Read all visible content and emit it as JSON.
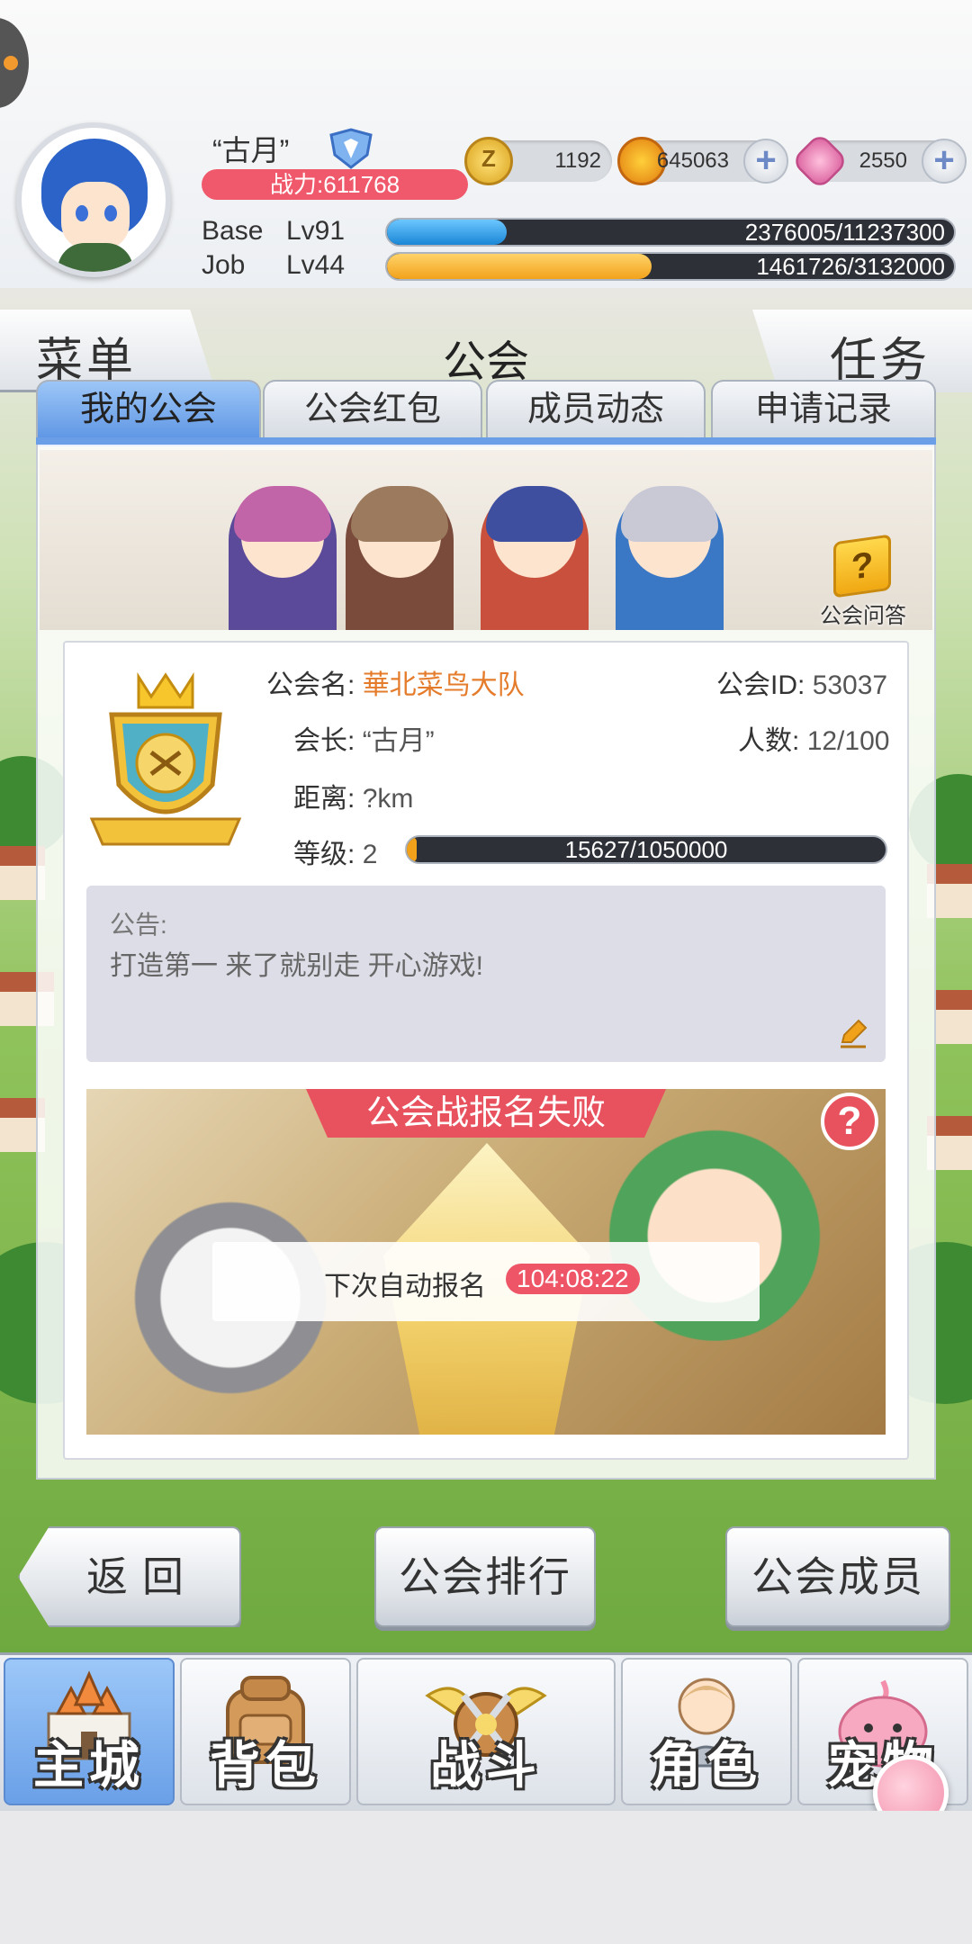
{
  "header": {
    "player_name": "“古月”",
    "power": "战力:611768",
    "currencies": {
      "zeny": "1192",
      "gold": "645063",
      "gem": "2550"
    },
    "base": {
      "label": "Base",
      "level": "Lv91",
      "exp": "2376005/11237300",
      "progress": 0.211
    },
    "job": {
      "label": "Job",
      "level": "Lv44",
      "exp": "1461726/3132000",
      "progress": 0.467
    }
  },
  "title_strip": {
    "menu": "菜单",
    "title": "公会",
    "task": "任务"
  },
  "tabs": [
    {
      "label": "我的公会",
      "active": true
    },
    {
      "label": "公会红包"
    },
    {
      "label": "成员动态"
    },
    {
      "label": "申请记录"
    }
  ],
  "quiz": {
    "label": "公会问答",
    "icon": "question-block-icon"
  },
  "guild": {
    "name_label": "公会名:",
    "name": "華北菜鸟大队",
    "id_label": "公会ID:",
    "id": "53037",
    "leader_label": "会长:",
    "leader": "“古月”",
    "count_label": "人数:",
    "count": "12/100",
    "distance_label": "距离:",
    "distance": "?km",
    "level_label": "等级:",
    "level": "2",
    "exp": "15627/1050000",
    "exp_progress": 0.015
  },
  "notice": {
    "title": "公告:",
    "text": "打造第一 来了就别走 开心游戏!"
  },
  "guild_war": {
    "status": "公会战报名失败",
    "auto_signup_label": "下次自动报名",
    "countdown": "104:08:22"
  },
  "actions": {
    "back": "返回",
    "ranking": "公会排行",
    "members": "公会成员"
  },
  "nav": [
    {
      "label": "主城",
      "icon": "castle-icon",
      "active": true
    },
    {
      "label": "背包",
      "icon": "backpack-icon"
    },
    {
      "label": "战斗",
      "icon": "crossed-swords-icon"
    },
    {
      "label": "角色",
      "icon": "character-icon"
    },
    {
      "label": "宠物",
      "icon": "pet-icon"
    }
  ],
  "colors": {
    "accent_blue": "#6a9ee6",
    "alert_red": "#e8525e",
    "guild_name_orange": "#e47c2c"
  }
}
